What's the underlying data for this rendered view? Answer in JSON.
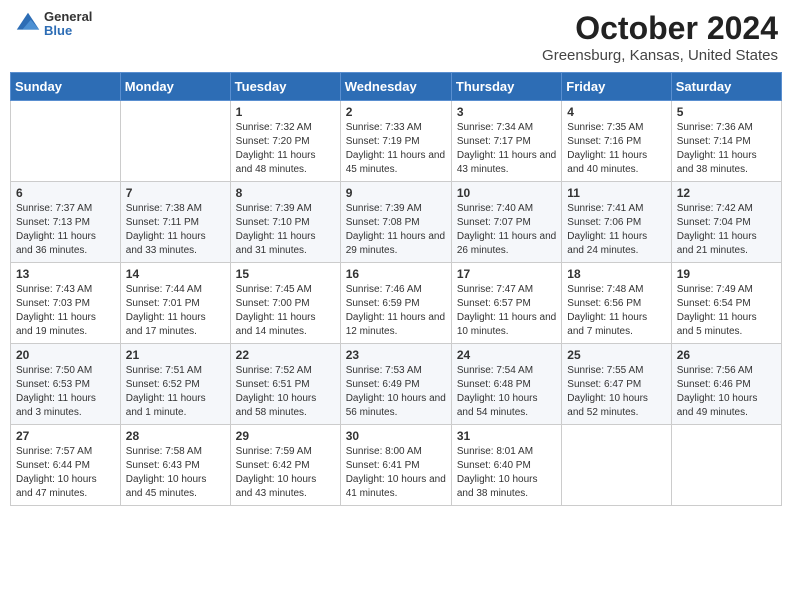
{
  "header": {
    "logo_general": "General",
    "logo_blue": "Blue",
    "title": "October 2024",
    "subtitle": "Greensburg, Kansas, United States"
  },
  "days_of_week": [
    "Sunday",
    "Monday",
    "Tuesday",
    "Wednesday",
    "Thursday",
    "Friday",
    "Saturday"
  ],
  "weeks": [
    [
      {
        "day": "",
        "info": ""
      },
      {
        "day": "",
        "info": ""
      },
      {
        "day": "1",
        "info": "Sunrise: 7:32 AM\nSunset: 7:20 PM\nDaylight: 11 hours and 48 minutes."
      },
      {
        "day": "2",
        "info": "Sunrise: 7:33 AM\nSunset: 7:19 PM\nDaylight: 11 hours and 45 minutes."
      },
      {
        "day": "3",
        "info": "Sunrise: 7:34 AM\nSunset: 7:17 PM\nDaylight: 11 hours and 43 minutes."
      },
      {
        "day": "4",
        "info": "Sunrise: 7:35 AM\nSunset: 7:16 PM\nDaylight: 11 hours and 40 minutes."
      },
      {
        "day": "5",
        "info": "Sunrise: 7:36 AM\nSunset: 7:14 PM\nDaylight: 11 hours and 38 minutes."
      }
    ],
    [
      {
        "day": "6",
        "info": "Sunrise: 7:37 AM\nSunset: 7:13 PM\nDaylight: 11 hours and 36 minutes."
      },
      {
        "day": "7",
        "info": "Sunrise: 7:38 AM\nSunset: 7:11 PM\nDaylight: 11 hours and 33 minutes."
      },
      {
        "day": "8",
        "info": "Sunrise: 7:39 AM\nSunset: 7:10 PM\nDaylight: 11 hours and 31 minutes."
      },
      {
        "day": "9",
        "info": "Sunrise: 7:39 AM\nSunset: 7:08 PM\nDaylight: 11 hours and 29 minutes."
      },
      {
        "day": "10",
        "info": "Sunrise: 7:40 AM\nSunset: 7:07 PM\nDaylight: 11 hours and 26 minutes."
      },
      {
        "day": "11",
        "info": "Sunrise: 7:41 AM\nSunset: 7:06 PM\nDaylight: 11 hours and 24 minutes."
      },
      {
        "day": "12",
        "info": "Sunrise: 7:42 AM\nSunset: 7:04 PM\nDaylight: 11 hours and 21 minutes."
      }
    ],
    [
      {
        "day": "13",
        "info": "Sunrise: 7:43 AM\nSunset: 7:03 PM\nDaylight: 11 hours and 19 minutes."
      },
      {
        "day": "14",
        "info": "Sunrise: 7:44 AM\nSunset: 7:01 PM\nDaylight: 11 hours and 17 minutes."
      },
      {
        "day": "15",
        "info": "Sunrise: 7:45 AM\nSunset: 7:00 PM\nDaylight: 11 hours and 14 minutes."
      },
      {
        "day": "16",
        "info": "Sunrise: 7:46 AM\nSunset: 6:59 PM\nDaylight: 11 hours and 12 minutes."
      },
      {
        "day": "17",
        "info": "Sunrise: 7:47 AM\nSunset: 6:57 PM\nDaylight: 11 hours and 10 minutes."
      },
      {
        "day": "18",
        "info": "Sunrise: 7:48 AM\nSunset: 6:56 PM\nDaylight: 11 hours and 7 minutes."
      },
      {
        "day": "19",
        "info": "Sunrise: 7:49 AM\nSunset: 6:54 PM\nDaylight: 11 hours and 5 minutes."
      }
    ],
    [
      {
        "day": "20",
        "info": "Sunrise: 7:50 AM\nSunset: 6:53 PM\nDaylight: 11 hours and 3 minutes."
      },
      {
        "day": "21",
        "info": "Sunrise: 7:51 AM\nSunset: 6:52 PM\nDaylight: 11 hours and 1 minute."
      },
      {
        "day": "22",
        "info": "Sunrise: 7:52 AM\nSunset: 6:51 PM\nDaylight: 10 hours and 58 minutes."
      },
      {
        "day": "23",
        "info": "Sunrise: 7:53 AM\nSunset: 6:49 PM\nDaylight: 10 hours and 56 minutes."
      },
      {
        "day": "24",
        "info": "Sunrise: 7:54 AM\nSunset: 6:48 PM\nDaylight: 10 hours and 54 minutes."
      },
      {
        "day": "25",
        "info": "Sunrise: 7:55 AM\nSunset: 6:47 PM\nDaylight: 10 hours and 52 minutes."
      },
      {
        "day": "26",
        "info": "Sunrise: 7:56 AM\nSunset: 6:46 PM\nDaylight: 10 hours and 49 minutes."
      }
    ],
    [
      {
        "day": "27",
        "info": "Sunrise: 7:57 AM\nSunset: 6:44 PM\nDaylight: 10 hours and 47 minutes."
      },
      {
        "day": "28",
        "info": "Sunrise: 7:58 AM\nSunset: 6:43 PM\nDaylight: 10 hours and 45 minutes."
      },
      {
        "day": "29",
        "info": "Sunrise: 7:59 AM\nSunset: 6:42 PM\nDaylight: 10 hours and 43 minutes."
      },
      {
        "day": "30",
        "info": "Sunrise: 8:00 AM\nSunset: 6:41 PM\nDaylight: 10 hours and 41 minutes."
      },
      {
        "day": "31",
        "info": "Sunrise: 8:01 AM\nSunset: 6:40 PM\nDaylight: 10 hours and 38 minutes."
      },
      {
        "day": "",
        "info": ""
      },
      {
        "day": "",
        "info": ""
      }
    ]
  ]
}
